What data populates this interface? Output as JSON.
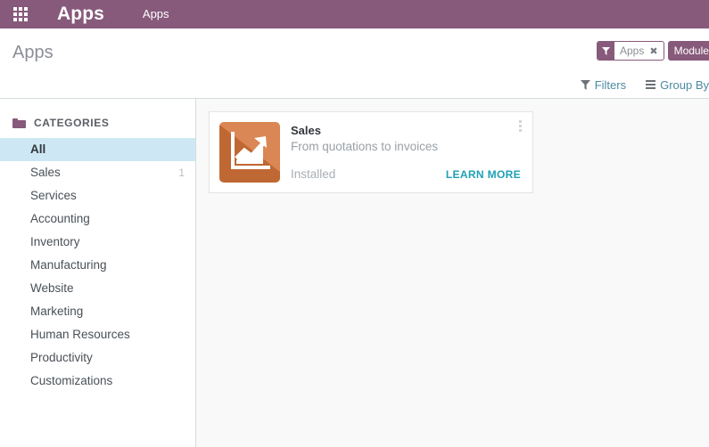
{
  "navbar": {
    "apps_grid_icon": "grid-apps-icon",
    "brand": "Apps",
    "breadcrumb": "Apps"
  },
  "control_panel": {
    "title": "Apps",
    "search_facets": [
      {
        "icon": "filter-funnel-icon",
        "label": "Apps",
        "removable": true,
        "close_glyph": "✖"
      },
      {
        "label": "Modules",
        "solid": true
      }
    ],
    "buttons": [
      {
        "icon": "filter-funnel-icon",
        "label": "Filters"
      },
      {
        "icon": "group-by-lines-icon",
        "label": "Group By"
      }
    ]
  },
  "sidebar": {
    "section_title": "CATEGORIES",
    "section_icon": "folder-icon",
    "items": [
      {
        "label": "All",
        "count": "",
        "active": true
      },
      {
        "label": "Sales",
        "count": "1",
        "active": false
      },
      {
        "label": "Services",
        "count": "",
        "active": false
      },
      {
        "label": "Accounting",
        "count": "",
        "active": false
      },
      {
        "label": "Inventory",
        "count": "",
        "active": false
      },
      {
        "label": "Manufacturing",
        "count": "",
        "active": false
      },
      {
        "label": "Website",
        "count": "",
        "active": false
      },
      {
        "label": "Marketing",
        "count": "",
        "active": false
      },
      {
        "label": "Human Resources",
        "count": "",
        "active": false
      },
      {
        "label": "Productivity",
        "count": "",
        "active": false
      },
      {
        "label": "Customizations",
        "count": "",
        "active": false
      }
    ]
  },
  "main": {
    "apps": [
      {
        "name": "Sales",
        "summary": "From quotations to invoices",
        "state": "Installed",
        "action_label": "LEARN MORE",
        "icon_name": "sales-chart-icon",
        "icon_bg": "#d4753c",
        "menu_icon": "kebab-menu-icon"
      }
    ]
  },
  "colors": {
    "brand_purple": "#875a7b",
    "accent_teal": "#1fa0b5",
    "selected_blue": "#cde8f4",
    "content_bg": "#f9f9f9",
    "border_grey": "#d5dbdb"
  }
}
